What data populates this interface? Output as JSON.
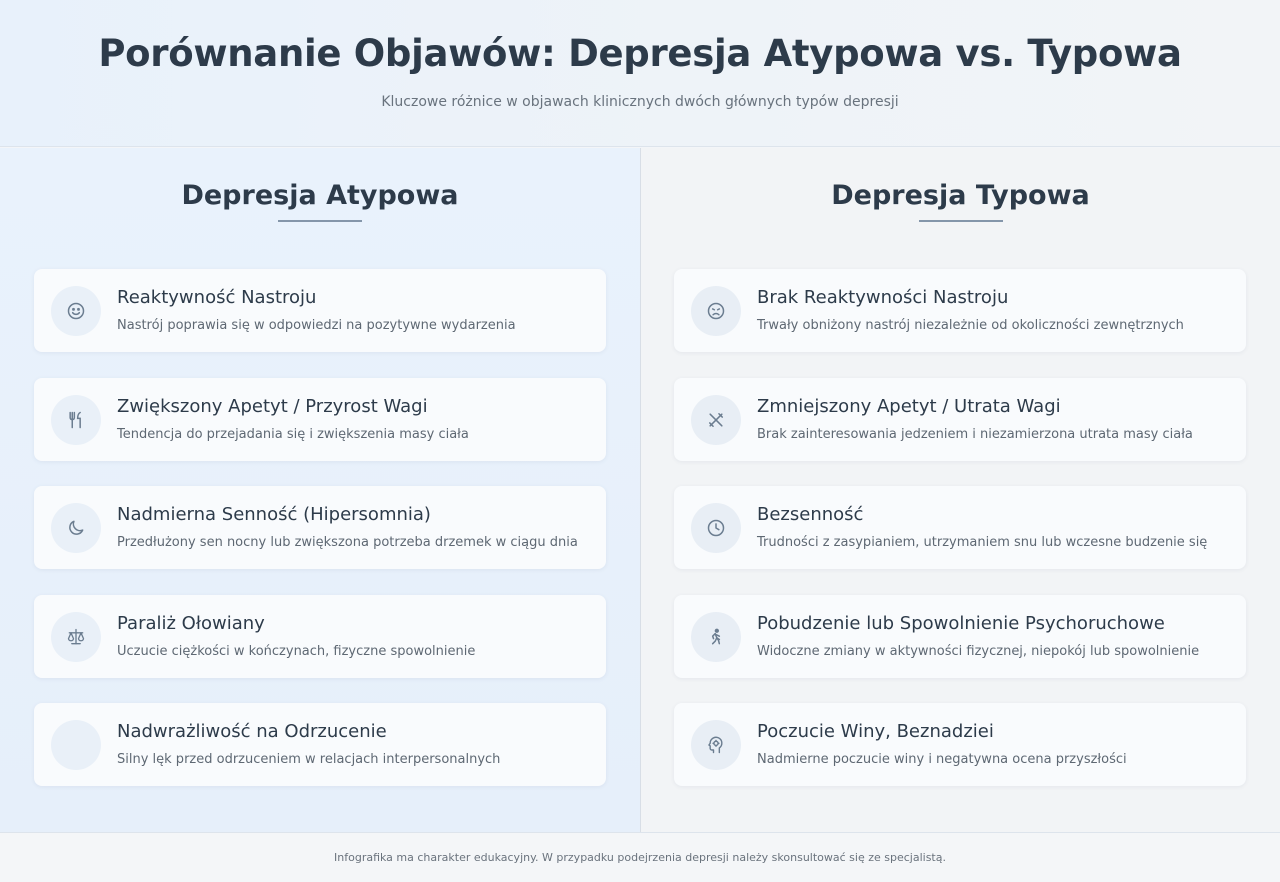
{
  "header": {
    "title": "Porównanie Objawów: Depresja Atypowa vs. Typowa",
    "subtitle": "Kluczowe różnice w objawach klinicznych dwóch głównych typów depresji"
  },
  "atypical": {
    "title": "Depresja Atypowa",
    "items": [
      {
        "icon": "smile-icon",
        "title": "Reaktywność Nastroju",
        "desc": "Nastrój poprawia się w odpowiedzi na pozytywne wydarzenia"
      },
      {
        "icon": "utensils-icon",
        "title": "Zwiększony Apetyt / Przyrost Wagi",
        "desc": "Tendencja do przejadania się i zwiększenia masy ciała"
      },
      {
        "icon": "moon-icon",
        "title": "Nadmierna Senność (Hipersomnia)",
        "desc": "Przedłużony sen nocny lub zwiększona potrzeba drzemek w ciągu dnia"
      },
      {
        "icon": "scale-icon",
        "title": "Paraliż Ołowiany",
        "desc": "Uczucie ciężkości w kończynach, fizyczne spowolnienie"
      },
      {
        "icon": "empty-icon",
        "title": "Nadwrażliwość na Odrzucenie",
        "desc": "Silny lęk przed odrzuceniem w relacjach interpersonalnych"
      }
    ]
  },
  "typical": {
    "title": "Depresja Typowa",
    "items": [
      {
        "icon": "sad-face-icon",
        "title": "Brak Reaktywności Nastroju",
        "desc": "Trwały obniżony nastrój niezależnie od okoliczności zewnętrznych"
      },
      {
        "icon": "utensils-crossed-icon",
        "title": "Zmniejszony Apetyt / Utrata Wagi",
        "desc": "Brak zainteresowania jedzeniem i niezamierzona utrata masy ciała"
      },
      {
        "icon": "clock-icon",
        "title": "Bezsenność",
        "desc": "Trudności z zasypianiem, utrzymaniem snu lub wczesne budzenie się"
      },
      {
        "icon": "walking-icon",
        "title": "Pobudzenie lub Spowolnienie Psychoruchowe",
        "desc": "Widoczne zmiany w aktywności fizycznej, niepokój lub spowolnienie"
      },
      {
        "icon": "head-brain-icon",
        "title": "Poczucie Winy, Beznadziei",
        "desc": "Nadmierne poczucie winy i negatywna ocena przyszłości"
      }
    ]
  },
  "footer": {
    "text": "Infografika ma charakter edukacyjny. W przypadku podejrzenia depresji należy skonsultować się ze specjalistą."
  },
  "colors": {
    "text": "#2d3b4a",
    "icon": "#6b7d90",
    "underline": "#8496aa"
  }
}
